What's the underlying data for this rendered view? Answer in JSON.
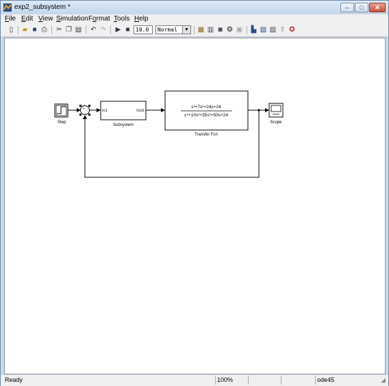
{
  "window": {
    "title": "exp2_subsystem *",
    "controls": {
      "minimize": "–",
      "maximize": "□",
      "close": "✕"
    }
  },
  "menubar": {
    "items": [
      {
        "label_pre": "",
        "mnemonic": "F",
        "label_post": "ile"
      },
      {
        "label_pre": "",
        "mnemonic": "E",
        "label_post": "dit"
      },
      {
        "label_pre": "",
        "mnemonic": "V",
        "label_post": "iew"
      },
      {
        "label_pre": "",
        "mnemonic": "S",
        "label_post": "imulation"
      },
      {
        "label_pre": "F",
        "mnemonic": "o",
        "label_post": "rmat"
      },
      {
        "label_pre": "",
        "mnemonic": "T",
        "label_post": "ools"
      },
      {
        "label_pre": "",
        "mnemonic": "H",
        "label_post": "elp"
      }
    ]
  },
  "toolbar": {
    "icons": [
      "new-icon",
      "open-icon",
      "save-icon",
      "print-icon",
      "cut-icon",
      "copy-icon",
      "paste-icon",
      "undo-icon",
      "redo-icon",
      "start-icon",
      "stop-icon"
    ],
    "stop_time": "10.0",
    "sim_mode": "Normal",
    "icons_right": [
      "build-icon",
      "update-icon",
      "model-advisor-icon",
      "debug-icon",
      "refresh-icon",
      "library-browser-icon",
      "model-explorer-icon",
      "debugger-icon",
      "parent-icon",
      "config-icon"
    ]
  },
  "diagram": {
    "blocks": {
      "step": {
        "label": "Step"
      },
      "subsystem": {
        "label": "Subsystem",
        "port_in": "In1",
        "port_out": "Out1"
      },
      "transfer_fcn": {
        "label": "Transfer Fcn",
        "numerator": "s³+7s²+24s+24",
        "denominator": "s⁴+10s³+35s²+50s+24"
      },
      "scope": {
        "label": "Scope"
      },
      "sum": {
        "signs": "+-"
      }
    }
  },
  "statusbar": {
    "state": "Ready",
    "zoom": "100%",
    "solver": "ode45"
  }
}
